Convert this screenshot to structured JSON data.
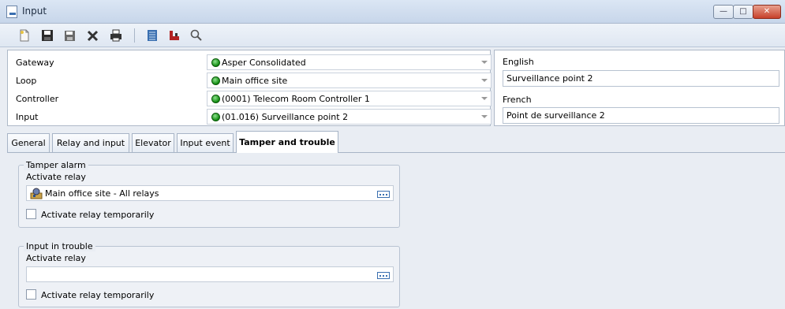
{
  "window": {
    "title": "Input"
  },
  "toolbar": {
    "buttons": [
      "new-icon",
      "save-icon",
      "save-as-icon",
      "delete-icon",
      "print-icon",
      "list-icon",
      "link-icon",
      "search-icon"
    ]
  },
  "header": {
    "gateway_label": "Gateway",
    "gateway_value": "Asper Consolidated",
    "loop_label": "Loop",
    "loop_value": "Main office site",
    "controller_label": "Controller",
    "controller_value": "(0001) Telecom Room Controller 1",
    "input_label": "Input",
    "input_value": "(01.016) Surveillance point 2"
  },
  "language": {
    "english_label": "English",
    "english_value": "Surveillance point 2",
    "french_label": "French",
    "french_value": "Point de surveillance 2"
  },
  "tabs": [
    "General",
    "Relay and input",
    "Elevator",
    "Input event",
    "Tamper and trouble"
  ],
  "active_tab": "Tamper and trouble",
  "tamper": {
    "legend": "Tamper alarm",
    "activate_label": "Activate relay",
    "relay_value": "Main office site - All relays",
    "temp_label": "Activate relay temporarily",
    "temp_checked": false
  },
  "trouble": {
    "legend": "Input in trouble",
    "activate_label": "Activate relay",
    "relay_value": "",
    "temp_label": "Activate relay temporarily",
    "temp_checked": false
  },
  "colors": {
    "status_green": "#0e8a0e",
    "accent": "#3a6fb0"
  }
}
